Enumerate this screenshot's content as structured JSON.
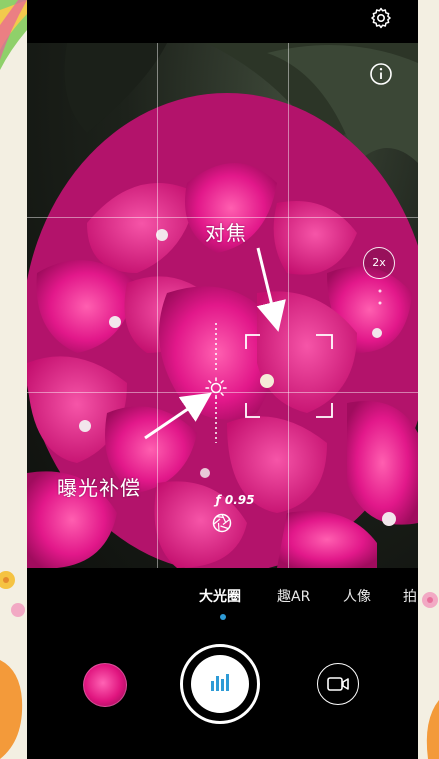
{
  "annotations": {
    "focus": "对焦",
    "exposure": "曝光补偿"
  },
  "viewfinder": {
    "zoom_label": "2x",
    "aperture_value": "ƒ 0.95"
  },
  "modes": {
    "items": [
      "大光圈",
      "趣AR",
      "人像",
      "拍"
    ],
    "active": "大光圈"
  },
  "icons": {
    "settings": "gear-icon",
    "info": "info-icon",
    "aperture": "aperture-icon",
    "exposure_sun": "sun-icon",
    "shutter_bars": "bars-icon",
    "video": "video-camera-icon"
  },
  "colors": {
    "accent": "#2e9bd6",
    "flower": "#e0157f"
  }
}
